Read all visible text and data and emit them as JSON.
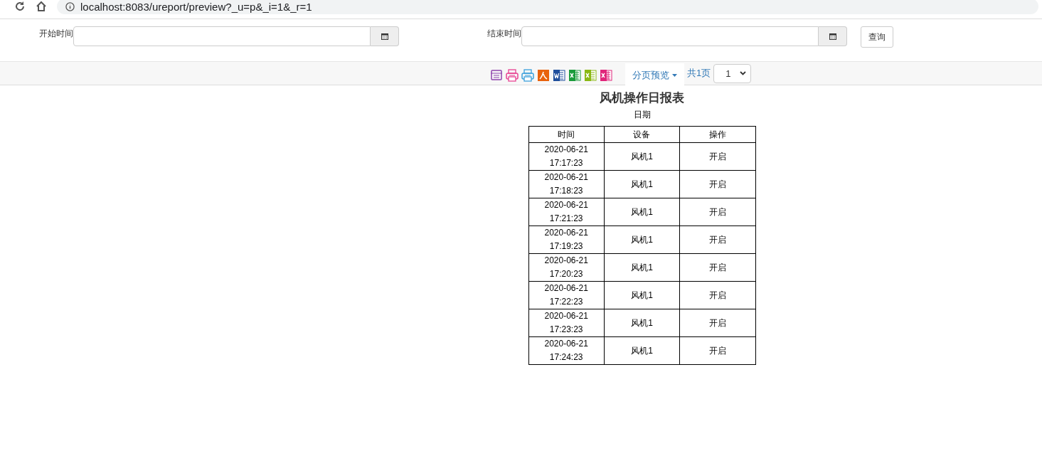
{
  "browser": {
    "url": "localhost:8083/ureport/preview?_u=p&_i=1&_r=1"
  },
  "search_form": {
    "fields": [
      {
        "label": "开始时间"
      },
      {
        "label": "结束时间"
      }
    ],
    "query_button": "查询"
  },
  "toolbar": {
    "paging_menu": "分页预览",
    "page_count": "共1页",
    "page_select": "1"
  },
  "report": {
    "title": "风机操作日报表",
    "subtitle": "日期",
    "columns": [
      "时间",
      "设备",
      "操作"
    ],
    "rows": [
      [
        "2020-06-21 17:17:23",
        "风机1",
        "开启"
      ],
      [
        "2020-06-21 17:18:23",
        "风机1",
        "开启"
      ],
      [
        "2020-06-21 17:21:23",
        "风机1",
        "开启"
      ],
      [
        "2020-06-21 17:19:23",
        "风机1",
        "开启"
      ],
      [
        "2020-06-21 17:20:23",
        "风机1",
        "开启"
      ],
      [
        "2020-06-21 17:22:23",
        "风机1",
        "开启"
      ],
      [
        "2020-06-21 17:23:23",
        "风机1",
        "开启"
      ],
      [
        "2020-06-21 17:24:23",
        "风机1",
        "开启"
      ]
    ]
  }
}
